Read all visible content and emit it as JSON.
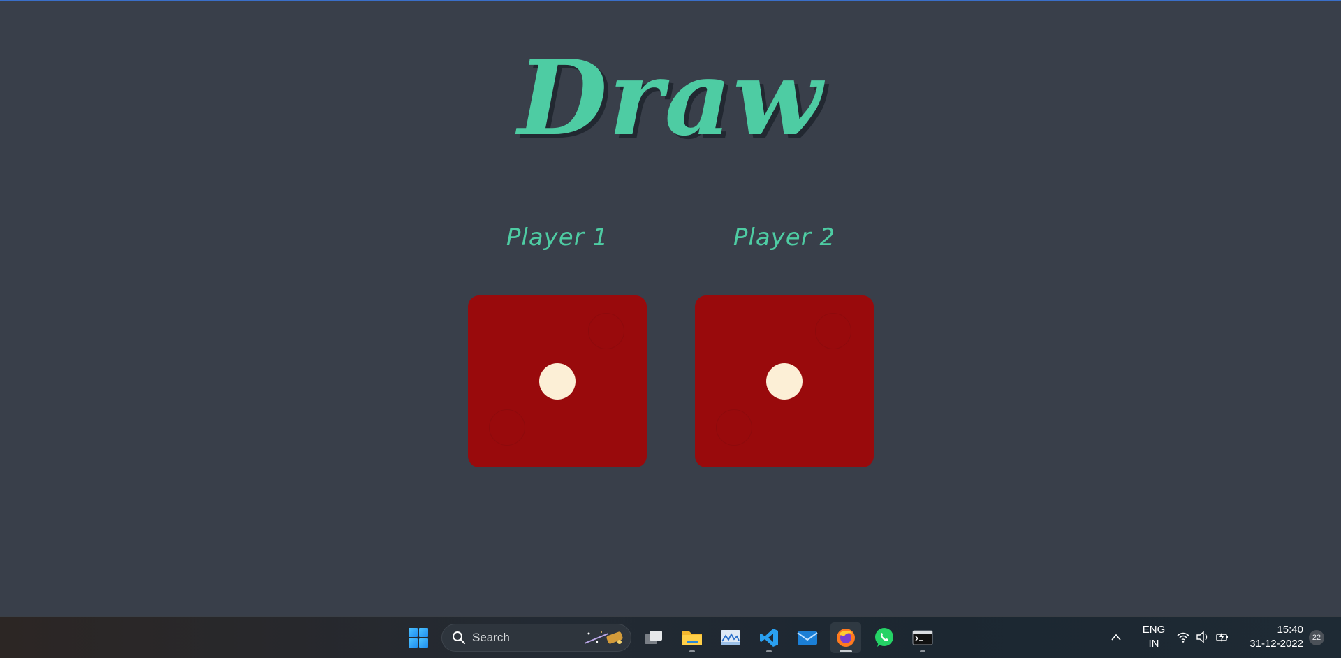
{
  "game": {
    "title": "Draw",
    "player1_label": "Player 1",
    "player2_label": "Player 2",
    "player1_die_value": 1,
    "player2_die_value": 1,
    "colors": {
      "background": "#393f4a",
      "title": "#4ecca3",
      "die": "#990a0c",
      "pip": "#fcefd6"
    }
  },
  "taskbar": {
    "search_placeholder": "Search",
    "apps": [
      "start-icon",
      "task-view-icon",
      "file-explorer-icon",
      "resource-monitor-icon",
      "vscode-icon",
      "mail-icon",
      "firefox-icon",
      "whatsapp-icon",
      "terminal-icon"
    ],
    "language_line1": "ENG",
    "language_line2": "IN",
    "time": "15:40",
    "date": "31-12-2022",
    "notification_count": "22"
  }
}
